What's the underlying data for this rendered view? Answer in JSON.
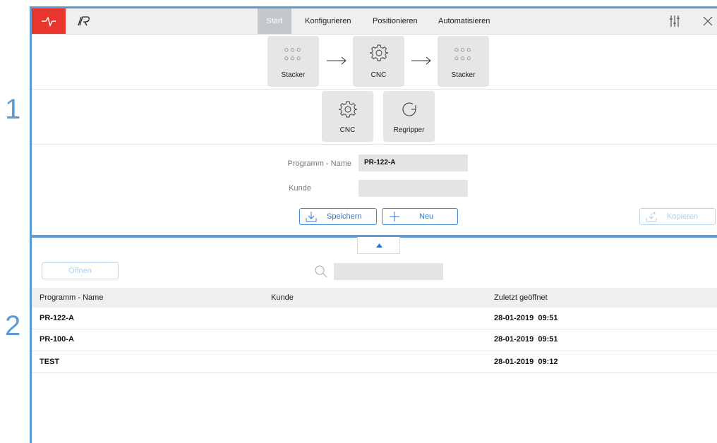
{
  "callouts": {
    "one": "1",
    "two": "2"
  },
  "nav": {
    "tabs": [
      {
        "label": "Start",
        "active": true
      },
      {
        "label": "Konfigurieren",
        "active": false
      },
      {
        "label": "Positionieren",
        "active": false
      },
      {
        "label": "Automatisieren",
        "active": false
      }
    ],
    "logo_icon": "pulse-icon",
    "brand_icon": "brand-logo-icon",
    "settings_icon": "sliders-icon",
    "close_icon": "close-icon"
  },
  "workflow": {
    "row1": [
      {
        "label": "Stacker",
        "icon": "dots-grid-icon"
      },
      {
        "label": "CNC",
        "icon": "gear-icon"
      },
      {
        "label": "Stacker",
        "icon": "dots-grid-icon"
      }
    ],
    "row2": [
      {
        "label": "CNC",
        "icon": "gear-icon"
      },
      {
        "label": "Regripper",
        "icon": "rotate-icon"
      }
    ]
  },
  "program_form": {
    "name_label": "Programm - Name",
    "name_value": "PR-122-A",
    "customer_label": "Kunde",
    "customer_value": "",
    "save_label": "Speichern",
    "new_label": "Neu",
    "copy_label": "Kopieren"
  },
  "list": {
    "open_label": "Öffnen",
    "search_placeholder": "",
    "columns": [
      "Programm - Name",
      "Kunde",
      "Zuletzt geöffnet"
    ],
    "rows": [
      {
        "name": "PR-122-A",
        "customer": "",
        "last_opened": "28-01-2019  09:51"
      },
      {
        "name": "PR-100-A",
        "customer": "",
        "last_opened": "28-01-2019  09:51"
      },
      {
        "name": "TEST",
        "customer": "",
        "last_opened": "28-01-2019  09:12"
      }
    ]
  },
  "colors": {
    "accent": "#3d8bd8",
    "brand_red": "#e8352e",
    "callout_blue": "#5b9bd5"
  }
}
